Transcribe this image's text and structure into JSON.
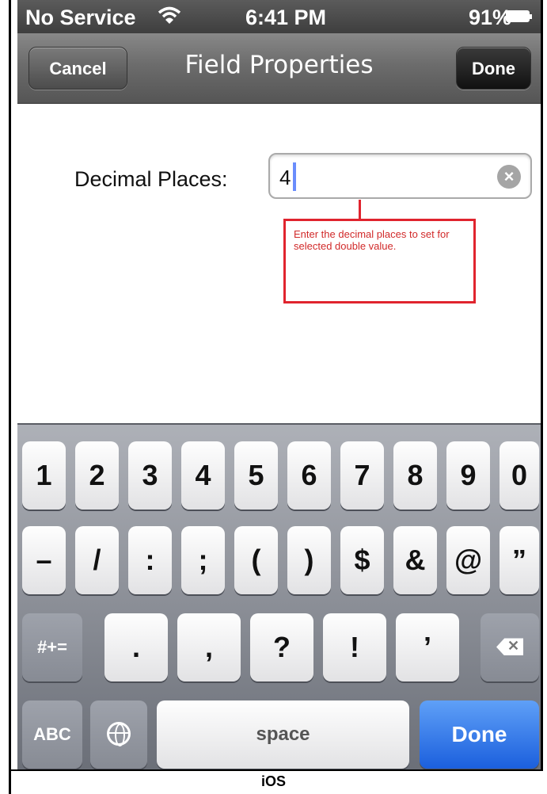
{
  "status_bar": {
    "carrier": "No Service",
    "wifi_icon": "wifi-icon",
    "time": "6:41 PM",
    "battery": "91%"
  },
  "nav_bar": {
    "cancel_label": "Cancel",
    "title": "Field Properties",
    "done_label": "Done"
  },
  "form": {
    "decimal_label": "Decimal Places:",
    "decimal_value": "4",
    "clear_icon": "clear-icon"
  },
  "annotation": {
    "text": "Enter the decimal places to set for selected double value.",
    "color": "#e0242e"
  },
  "keyboard": {
    "row1": [
      "1",
      "2",
      "3",
      "4",
      "5",
      "6",
      "7",
      "8",
      "9",
      "0"
    ],
    "row2": [
      "–",
      "/",
      ":",
      ";",
      "(",
      ")",
      "$",
      "&",
      "@",
      "”"
    ],
    "row3": {
      "symbols_toggle": "#+=",
      "keys": [
        ".",
        ",",
        "?",
        "!",
        "’"
      ]
    },
    "row4": {
      "abc": "ABC",
      "space": "space",
      "done": "Done"
    },
    "done_color": "#1b5fdd"
  },
  "caption": "iOS"
}
